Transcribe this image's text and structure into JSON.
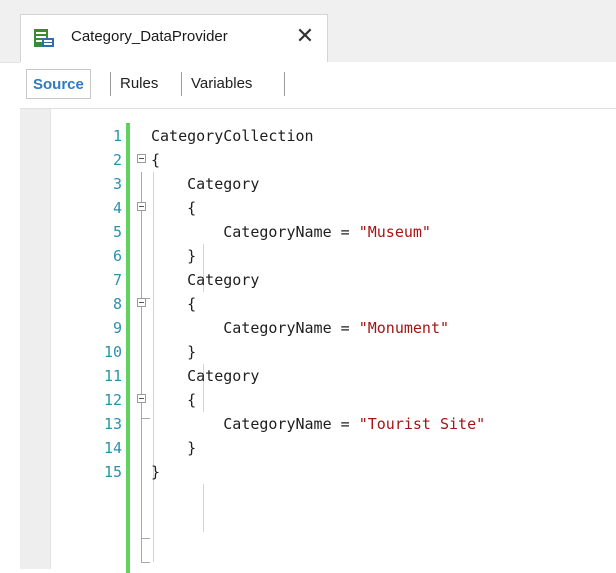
{
  "window": {
    "title": "Category_DataProvider",
    "icon": "data-provider-icon",
    "close_glyph": "✕"
  },
  "subtabs": [
    {
      "label": "Source",
      "active": true
    },
    {
      "label": "Rules",
      "active": false
    },
    {
      "label": "Variables",
      "active": false
    }
  ],
  "editor": {
    "lines": [
      {
        "num": "1",
        "code": "CategoryCollection",
        "str": ""
      },
      {
        "num": "2",
        "code": "{",
        "str": ""
      },
      {
        "num": "3",
        "code": "    Category",
        "str": ""
      },
      {
        "num": "4",
        "code": "    {",
        "str": ""
      },
      {
        "num": "5",
        "code": "        CategoryName = ",
        "str": "\"Museum\""
      },
      {
        "num": "6",
        "code": "    }",
        "str": ""
      },
      {
        "num": "7",
        "code": "    Category",
        "str": ""
      },
      {
        "num": "8",
        "code": "    {",
        "str": ""
      },
      {
        "num": "9",
        "code": "        CategoryName = ",
        "str": "\"Monument\""
      },
      {
        "num": "10",
        "code": "    }",
        "str": ""
      },
      {
        "num": "11",
        "code": "    Category",
        "str": ""
      },
      {
        "num": "12",
        "code": "    {",
        "str": ""
      },
      {
        "num": "13",
        "code": "        CategoryName = ",
        "str": "\"Tourist Site\""
      },
      {
        "num": "14",
        "code": "    }",
        "str": ""
      },
      {
        "num": "15",
        "code": "}",
        "str": ""
      }
    ]
  },
  "colors": {
    "line_number": "#2b91af",
    "string": "#a31515",
    "active_tab": "#2e7bc4",
    "change_bar": "#5fd35f"
  }
}
